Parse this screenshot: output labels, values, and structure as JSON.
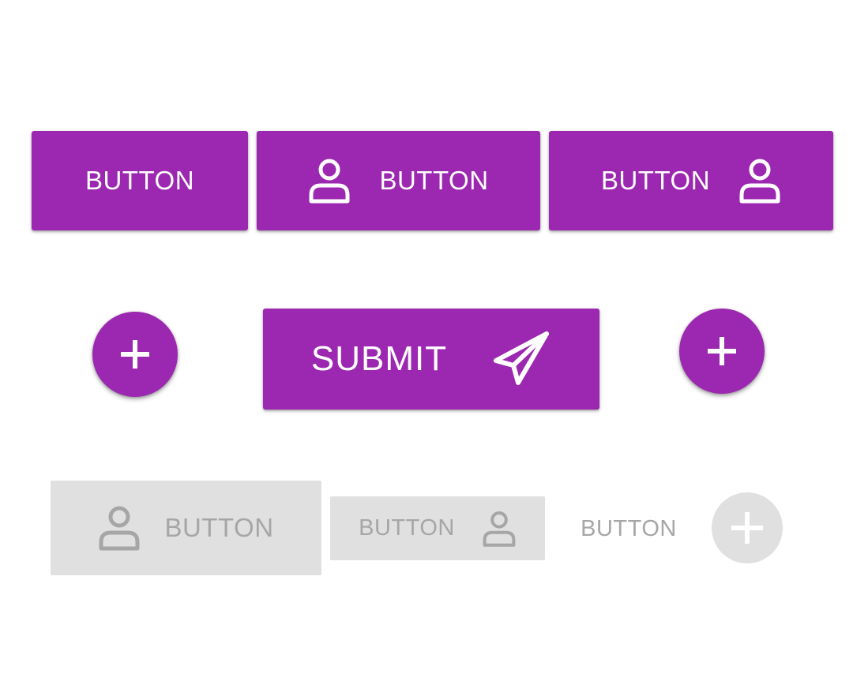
{
  "colors": {
    "primary": "#9c27b0",
    "on_primary": "#ffffff",
    "disabled_bg": "#e0e0e0",
    "disabled_fg": "#a6a6a6"
  },
  "row1": {
    "text_button": {
      "label": "BUTTON"
    },
    "icon_left_button": {
      "label": "BUTTON",
      "icon": "person-icon"
    },
    "icon_right_button": {
      "label": "BUTTON",
      "icon": "person-icon"
    }
  },
  "row2": {
    "fab_left": {
      "icon": "plus-icon"
    },
    "submit_button": {
      "label": "SUBMIT",
      "icon": "paper-plane-icon"
    },
    "fab_right": {
      "icon": "plus-icon"
    }
  },
  "row3": {
    "disabled_large_button": {
      "label": "BUTTON",
      "icon": "person-icon"
    },
    "disabled_small_button": {
      "label": "BUTTON",
      "icon": "person-icon"
    },
    "disabled_text_button": {
      "label": "BUTTON"
    },
    "disabled_fab": {
      "icon": "plus-icon"
    }
  }
}
